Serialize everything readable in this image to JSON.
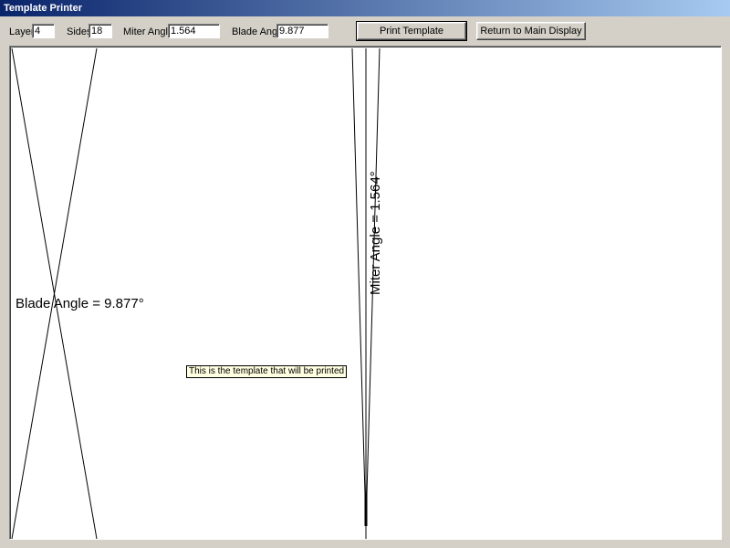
{
  "window": {
    "title": "Template Printer"
  },
  "controls": {
    "layer": {
      "label": "Layer:",
      "value": "4"
    },
    "sides": {
      "label": "Sides:",
      "value": "18"
    },
    "miter_angle": {
      "label": "Miter Angle:",
      "value": "1.564"
    },
    "blade_angle": {
      "label": "Blade Angle:",
      "value": "9.877"
    },
    "print_button": "Print Template",
    "return_button": "Return to Main Display"
  },
  "template": {
    "blade_angle_text": "Blade Angle = 9.877°",
    "miter_angle_text": "Miter Angle = 1.564°",
    "tooltip": "This is the template that will be printed"
  }
}
